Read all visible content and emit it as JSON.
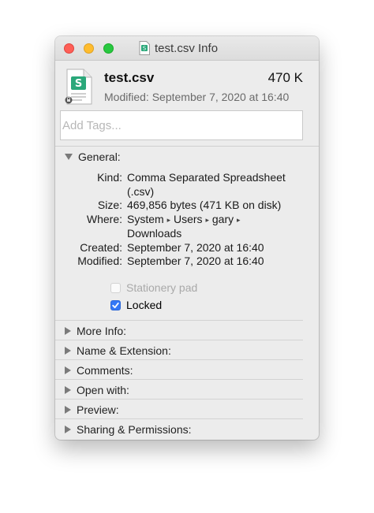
{
  "window": {
    "title": "test.csv Info",
    "traffic_lights": {
      "close": "#fe5f57",
      "minimize": "#febc2e",
      "zoom": "#28c840"
    }
  },
  "file": {
    "name": "test.csv",
    "size": "470 K",
    "modified_line": "Modified: September 7, 2020 at 16:40",
    "icon": "spreadsheet-file-icon",
    "icon_color": "#2aa87a"
  },
  "tags": {
    "placeholder": "Add Tags..."
  },
  "general": {
    "label": "General:",
    "rows": [
      {
        "key": "Kind:",
        "lines": [
          "Comma Separated Spreadsheet",
          "(.csv)"
        ]
      },
      {
        "key": "Size:",
        "lines": [
          "469,856 bytes (471 KB on disk)"
        ]
      },
      {
        "key": "Where:",
        "path": [
          "System",
          "Users",
          "gary"
        ],
        "path_tail": "Downloads"
      },
      {
        "key": "Created:",
        "lines": [
          "September 7, 2020 at 16:40"
        ]
      },
      {
        "key": "Modified:",
        "lines": [
          "September 7, 2020 at 16:40"
        ]
      }
    ],
    "path_separator": "▸",
    "stationery_pad": {
      "label": "Stationery pad",
      "checked": false,
      "enabled": false
    },
    "locked": {
      "label": "Locked",
      "checked": true,
      "enabled": true
    }
  },
  "sections": [
    {
      "label": "More Info:"
    },
    {
      "label": "Name & Extension:"
    },
    {
      "label": "Comments:"
    },
    {
      "label": "Open with:"
    },
    {
      "label": "Preview:"
    },
    {
      "label": "Sharing & Permissions:"
    }
  ]
}
